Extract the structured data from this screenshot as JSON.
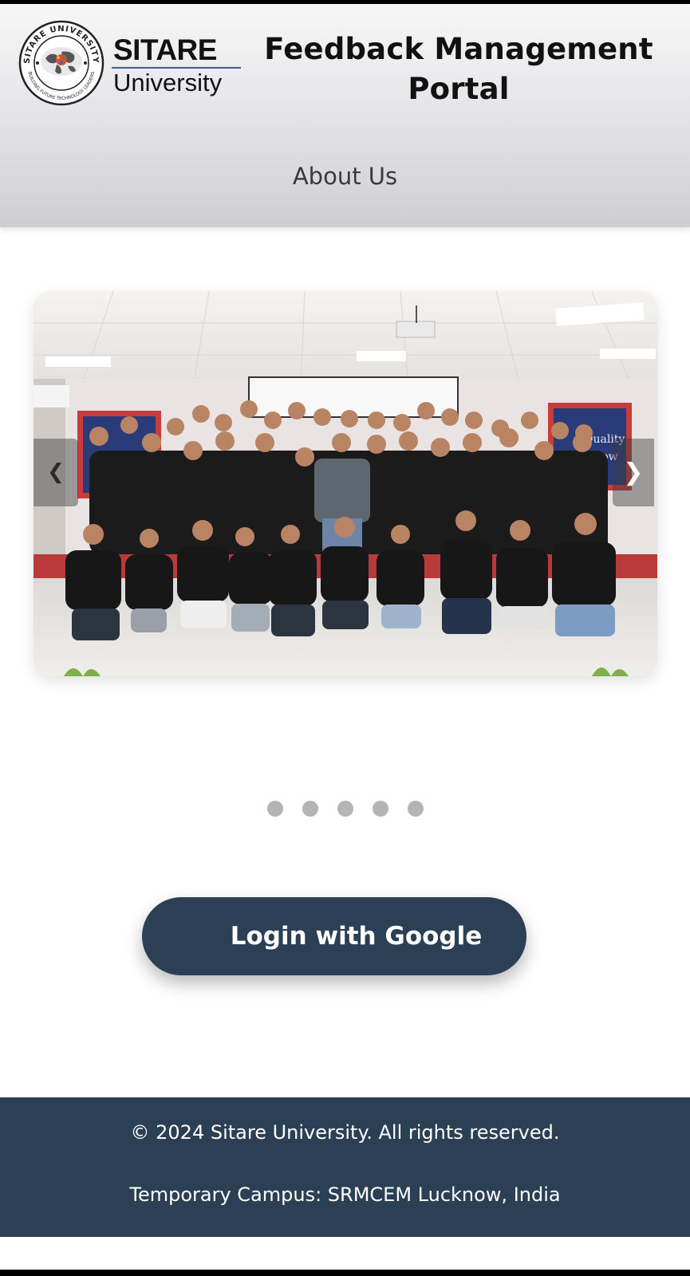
{
  "header": {
    "logo_seal_text": "SITARE UNIVERSITY · BUILDING FUTURE TECHNOLOGY LEADERS",
    "brand_name": "SITARE",
    "brand_sub": "University",
    "portal_title_line1": "Feedback Management",
    "portal_title_line2": "Portal",
    "nav_about": "About Us"
  },
  "carousel": {
    "image_subject": "group photo of students in black polo shirts in an auditorium",
    "banner_text": "Quality\nNow",
    "next_glyph": "❯",
    "prev_glyph": "❮",
    "slide_count": 5,
    "active_index": 0
  },
  "login": {
    "button_label": "Login with Google"
  },
  "footer": {
    "copyright": "© 2024 Sitare University. All rights reserved.",
    "campus": "Temporary Campus: SRMCEM Lucknow, India"
  },
  "colors": {
    "primary": "#2b3f55",
    "dot": "#b4b4b4",
    "header_top": "#f7f7f8",
    "header_bottom": "#cfcfd1"
  }
}
